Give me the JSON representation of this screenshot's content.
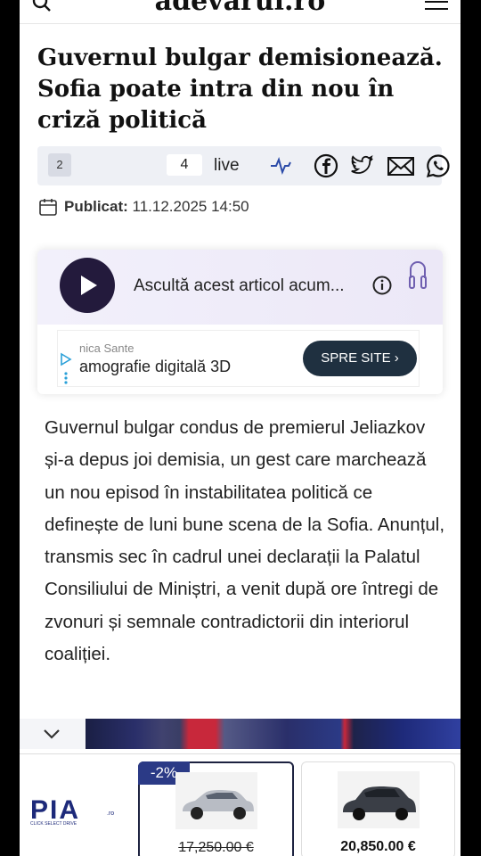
{
  "header": {
    "logo": "adevarul.ro"
  },
  "article": {
    "title": "Guvernul bulgar demisionează. Sofia poate intra din nou în criză politică",
    "comments_count": "2",
    "live_count": "4",
    "live_label": "live",
    "published_label": "Publicat:",
    "published_value": "11.12.2025 14:50",
    "body": "Guvernul bulgar condus de premierul Jeliazkov și-a depus joi demisia, un gest care marchează un nou episod în instabilitatea politică ce definește de luni bune scena de la Sofia. Anunțul, transmis sec în cadrul unei declarații la Palatul Consiliului de Miniștri, a venit după ore întregi de zvonuri și semnale contradictorii din interiorul coaliției."
  },
  "share": {
    "icons": [
      "facebook-icon",
      "twitter-icon",
      "mail-icon",
      "whatsapp-icon"
    ]
  },
  "audio": {
    "label": "Ascultă acest articol acum..."
  },
  "ad": {
    "small_text": "nica Sante",
    "big_text": "amografie digitală 3D",
    "button_label": "SPRE SITE ›"
  },
  "bottom_ad": {
    "logo": "PIA.ro",
    "tagline": "CLICK SELECT DRIVE",
    "cars": [
      {
        "badge": "-2%",
        "price": "17,250.00 €"
      },
      {
        "price": "20,850.00 €"
      }
    ]
  },
  "colors": {
    "play_bg": "#231a3c",
    "ad_button": "#1f3040",
    "badge": "#2b3a86"
  }
}
